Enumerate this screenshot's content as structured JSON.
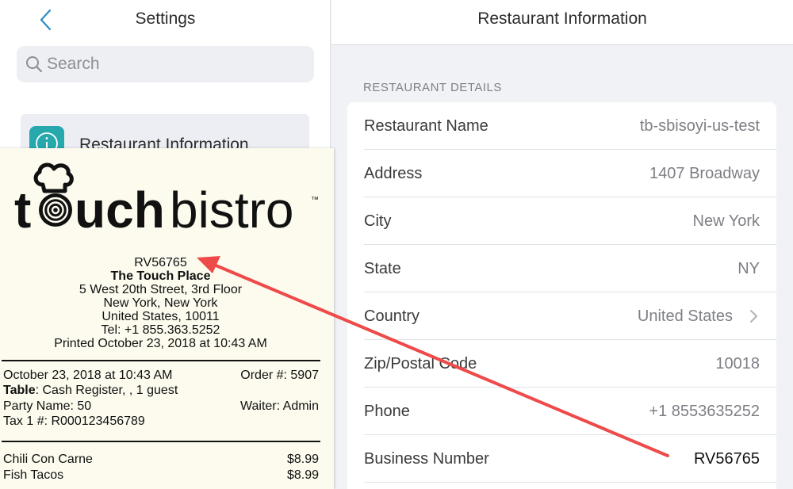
{
  "settings": {
    "title": "Settings",
    "search_placeholder": "Search",
    "nav_items": [
      {
        "label": "Restaurant Information",
        "icon": "info-icon"
      }
    ]
  },
  "detail": {
    "title": "Restaurant Information",
    "section_label": "RESTAURANT DETAILS",
    "rows": [
      {
        "label": "Restaurant Name",
        "value": "tb-sbisoyi-us-test"
      },
      {
        "label": "Address",
        "value": "1407 Broadway"
      },
      {
        "label": "City",
        "value": "New York"
      },
      {
        "label": "State",
        "value": "NY"
      },
      {
        "label": "Country",
        "value": "United States"
      },
      {
        "label": "Zip/Postal Code",
        "value": "10018"
      },
      {
        "label": "Phone",
        "value": "+1 8553635252"
      },
      {
        "label": "Business Number",
        "value": "RV56765"
      }
    ]
  },
  "receipt": {
    "logo_text": "touchbistro",
    "header_lines": [
      "RV56765",
      "The Touch Place",
      "5 West 20th Street, 3rd Floor",
      "New York, New York",
      "United States, 10011",
      "Tel: +1 855.363.5252",
      "Printed October 23, 2018 at 10:43 AM"
    ],
    "date_time": "October 23, 2018 at 10:43 AM",
    "order_number": "Order #: 5907",
    "table_label": "Table",
    "table_value": ": Cash Register, , 1 guest",
    "party_name": "Party Name: 50",
    "waiter": "Waiter: Admin",
    "tax_line": "Tax 1 #: R000123456789",
    "items": [
      {
        "name": "Chili Con Carne",
        "price": "$8.99"
      },
      {
        "name": "Fish Tacos",
        "price": "$8.99"
      }
    ]
  },
  "colors": {
    "accent": "#26a8ad",
    "arrow": "#ef4a4a",
    "receipt_bg": "#fcfbee"
  }
}
